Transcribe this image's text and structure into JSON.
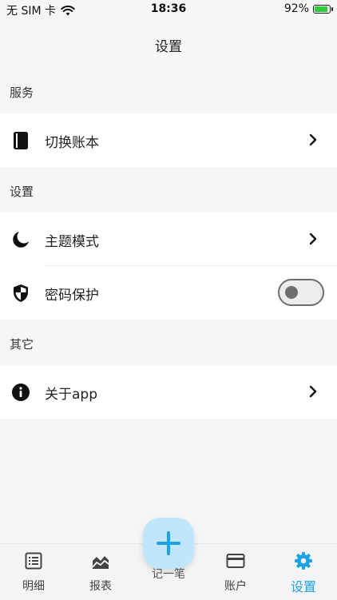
{
  "status_bar": {
    "carrier": "无 SIM 卡",
    "time": "18:36",
    "battery": "92%",
    "battery_level": 0.92
  },
  "nav": {
    "title": "设置"
  },
  "sections": [
    {
      "header": "服务",
      "items": [
        {
          "label": "切换账本",
          "icon": "book-icon",
          "control": "chevron"
        }
      ]
    },
    {
      "header": "设置",
      "items": [
        {
          "label": "主题模式",
          "icon": "moon-icon",
          "control": "chevron"
        },
        {
          "label": "密码保护",
          "icon": "shield-icon",
          "control": "toggle",
          "toggle_on": false
        }
      ]
    },
    {
      "header": "其它",
      "items": [
        {
          "label": "关于app",
          "icon": "info-icon",
          "control": "chevron"
        }
      ]
    }
  ],
  "tabbar": {
    "tabs": [
      {
        "label": "明细",
        "icon": "list-icon"
      },
      {
        "label": "报表",
        "icon": "chart-icon"
      },
      {
        "label": "记一笔",
        "icon": "plus-icon"
      },
      {
        "label": "账户",
        "icon": "card-icon"
      },
      {
        "label": "设置",
        "icon": "gear-icon",
        "active": true
      }
    ]
  },
  "colors": {
    "accent": "#1aa1e6",
    "background": "#f6f6f7",
    "fab": "#bfe6fb"
  }
}
